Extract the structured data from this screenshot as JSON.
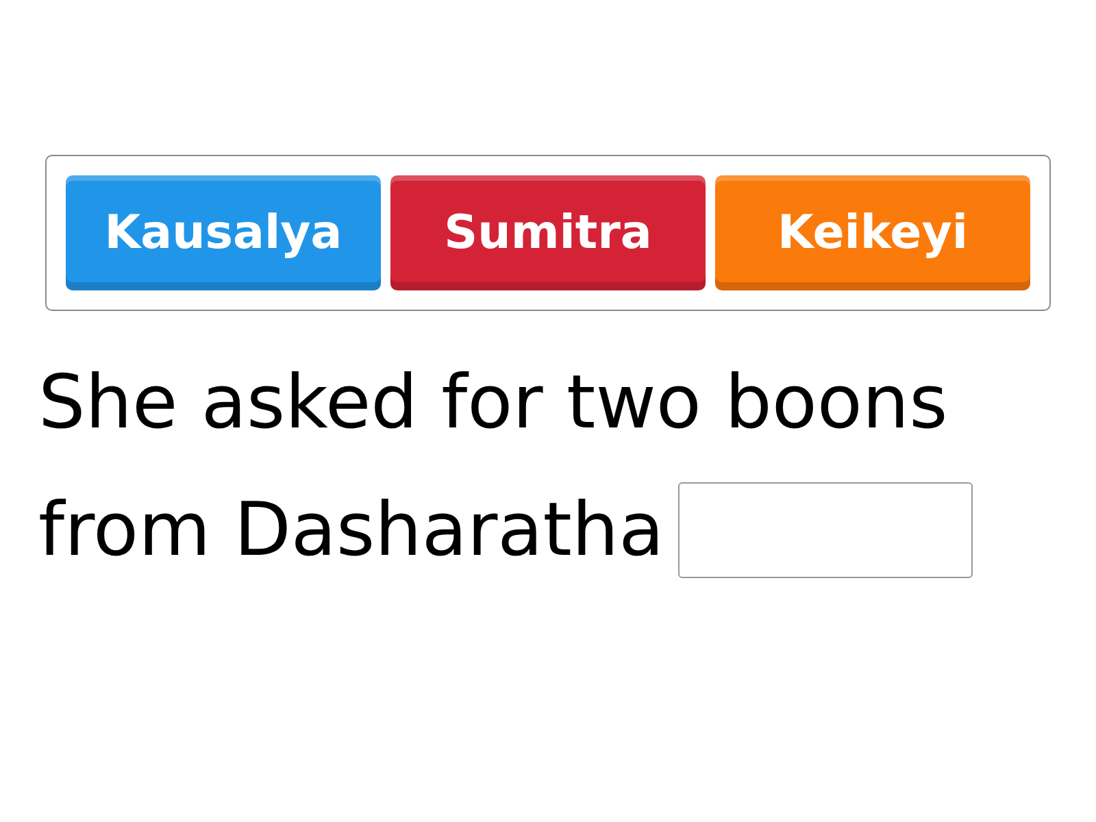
{
  "options": [
    {
      "label": "Kausalya",
      "color": "#2196e8"
    },
    {
      "label": "Sumitra",
      "color": "#d42336"
    },
    {
      "label": "Keikeyi",
      "color": "#fb7a0c"
    }
  ],
  "question": {
    "lines": [
      "She asked for two boons",
      "from Dasharatha"
    ]
  }
}
